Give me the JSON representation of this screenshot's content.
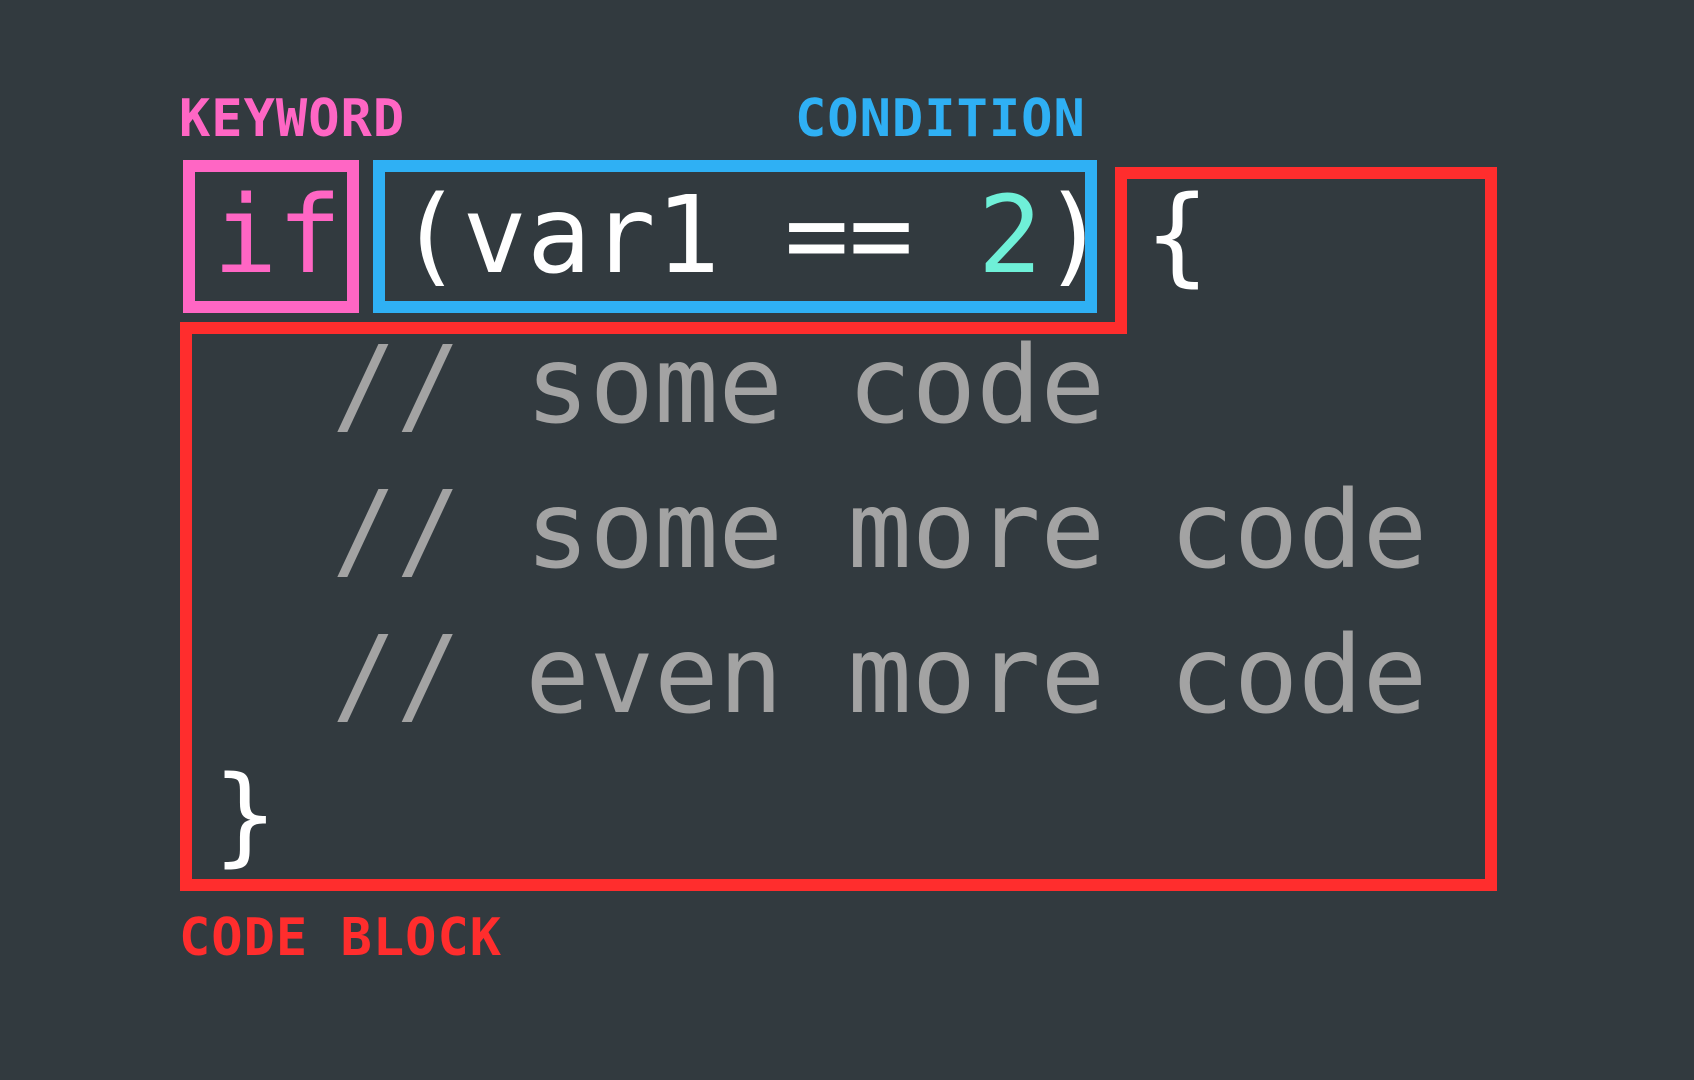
{
  "colors": {
    "background": "#323a3f",
    "keyword": "#ff66c4",
    "condition": "#2fb0f4",
    "code_block": "#ff2d2d",
    "number": "#6ff0d8",
    "text": "#ffffff",
    "comment": "#a3a3a3"
  },
  "labels": {
    "keyword": "KEYWORD",
    "condition": "CONDITION",
    "code_block": "CODE BLOCK"
  },
  "code": {
    "keyword": "if",
    "condition_open": "(var1 == ",
    "condition_number": "2",
    "condition_close": ")",
    "open_brace": "{",
    "comments": [
      "// some code",
      "// some more code",
      "// even more code"
    ],
    "close_brace": "}"
  }
}
